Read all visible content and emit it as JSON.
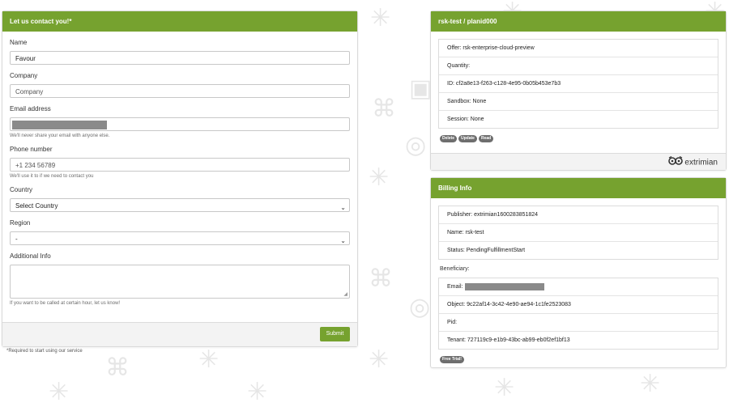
{
  "contact": {
    "title": "Let us contact you!*",
    "name_label": "Name",
    "name_value": "Favour",
    "company_label": "Company",
    "company_placeholder": "Company",
    "email_label": "Email address",
    "email_help": "We'll never share your email with anyone else.",
    "phone_label": "Phone number",
    "phone_placeholder": "+1 234 56789",
    "phone_help": "We'll use it to if we need to contact you",
    "country_label": "Country",
    "country_value": "Select Country",
    "region_label": "Region",
    "region_value": "-",
    "info_label": "Additional Info",
    "info_help": "If you want to be called at certain hour, let us know!",
    "submit_label": "Submit",
    "required_note": "*Required to start using our service"
  },
  "plan": {
    "title": "rsk-test / planid000",
    "rows": [
      "Offer: rsk-enterprise-cloud-preview",
      "Quantity:",
      "ID: cf2a8e13-f263-c128-4e95-0b05b453e7b3",
      "Sandbox: None",
      "Session: None"
    ],
    "badges": [
      "Delete",
      "Update",
      "Read"
    ],
    "brand": "extrimian"
  },
  "billing": {
    "title": "Billing Info",
    "rows": [
      "Publisher: extrimian1600283851824",
      "Name: rsk-test",
      "Status: PendingFulfillmentStart"
    ],
    "beneficiary_label": "Beneficiary:",
    "beneficiary_rows": [
      "Email:",
      "Object: 9c22af14-3c42-4e90-ae94-1c1fe2523083",
      "Pid:",
      "Tenant: 727119c9-e1b9-43bc-ab99-eb0f2ef1bf13"
    ],
    "badge": "Free Trial!"
  },
  "colors": {
    "accent": "#76a22f",
    "badge": "#6e6e6e"
  },
  "icons": [
    "chevron-down-icon",
    "owl-logo-icon",
    "resize-grip-icon"
  ]
}
